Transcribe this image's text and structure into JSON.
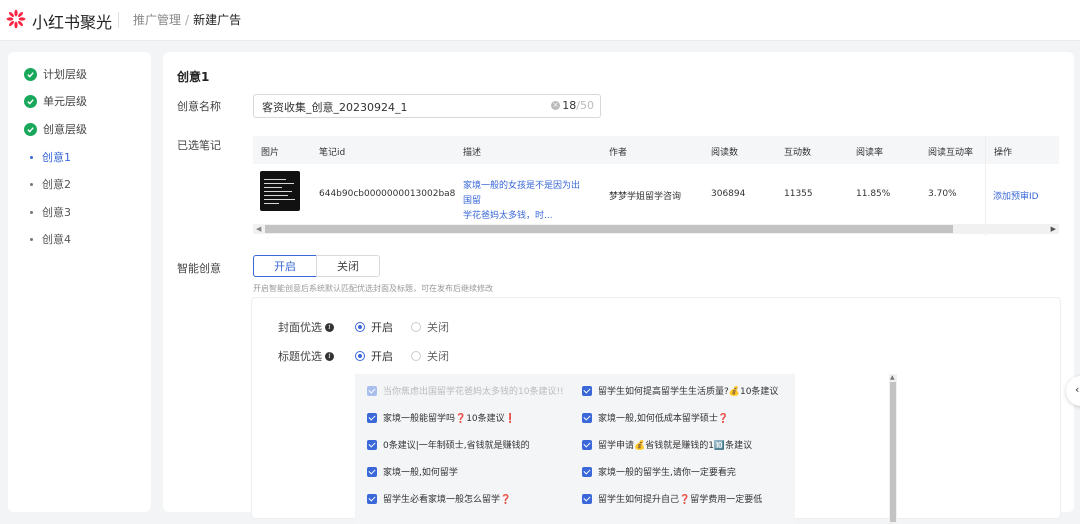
{
  "header": {
    "brand": "小红书聚光",
    "breadcrumb": {
      "parent": "推广管理",
      "separator": "/",
      "current": "新建广告"
    }
  },
  "sidebar": {
    "steps": [
      {
        "label": "计划层级",
        "done": true
      },
      {
        "label": "单元层级",
        "done": true
      },
      {
        "label": "创意层级",
        "done": true
      }
    ],
    "creatives": [
      {
        "label": "创意1",
        "active": true
      },
      {
        "label": "创意2",
        "active": false
      },
      {
        "label": "创意3",
        "active": false
      },
      {
        "label": "创意4",
        "active": false
      }
    ]
  },
  "creative": {
    "title": "创意1",
    "name_label": "创意名称",
    "name_value": "客资收集_创意_20230924_1",
    "name_count": "18",
    "name_max": "/50",
    "notes_label": "已选笔记",
    "table": {
      "headers": [
        "图片",
        "笔记id",
        "描述",
        "作者",
        "阅读数",
        "互动数",
        "阅读率",
        "阅读互动率",
        "操作"
      ],
      "row": {
        "note_id": "644b90cb0000000013002ba8",
        "desc_line1": "家境一般的女孩是不是因为出国留",
        "desc_line2": "学花爸妈太多钱，时...",
        "author": "梦梦学姐留学咨询",
        "reads": "306894",
        "interactions": "11355",
        "read_rate": "11.85%",
        "read_interaction_rate": "3.70%",
        "action": "添加预审ID"
      }
    },
    "smart_label": "智能创意",
    "smart_on": "开启",
    "smart_off": "关闭",
    "smart_hint": "开启智能创意后系统默认匹配优选封面及标题，可在发布后继续修改",
    "cover_label": "封面优选",
    "title_label": "标题优选",
    "radio_on": "开启",
    "radio_off": "关闭",
    "titles_left": [
      {
        "text": "当你焦虑出国留学花爸妈太多钱的10条建议!!",
        "disabled": true
      },
      {
        "text": "家境一般能留学吗❓10条建议❗",
        "disabled": false
      },
      {
        "text": "0条建议|一年制硕士,省钱就是赚钱的",
        "disabled": false
      },
      {
        "text": "家境一般,如何留学",
        "disabled": false
      },
      {
        "text": "留学生必看家境一般怎么留学❓",
        "disabled": false
      }
    ],
    "titles_right": [
      {
        "text": "留学生如何提高留学生生活质量?💰10条建议",
        "disabled": false
      },
      {
        "text": "家境一般,如何低成本留学硕士❓",
        "disabled": false
      },
      {
        "text": "留学申请💰省钱就是赚钱的1🔟条建议",
        "disabled": false
      },
      {
        "text": "家境一般的留学生,请你一定要看完",
        "disabled": false
      },
      {
        "text": "留学生如何提升自己❓留学费用一定要低",
        "disabled": false
      }
    ]
  },
  "colors": {
    "accent": "#3a68d8",
    "success": "#19a85b",
    "brand": "#ff2442"
  },
  "icons": {
    "logo": "flower-logo-icon",
    "done": "check-circle-icon",
    "clear": "clear-icon",
    "info": "info-icon",
    "float": "chevron-left-icon"
  }
}
